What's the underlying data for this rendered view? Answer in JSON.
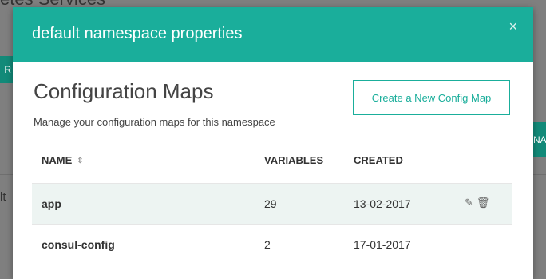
{
  "background": {
    "page_title_fragment": "etes Services",
    "left_tab_fragment": "R",
    "right_tab_fragment": "NA",
    "side_text_fragment": "lt"
  },
  "modal": {
    "title": "default namespace properties",
    "close_icon": "×"
  },
  "section": {
    "title": "Configuration Maps",
    "subtitle": "Manage your configuration maps for this namespace",
    "create_button_label": "Create a New Config Map"
  },
  "table": {
    "headers": {
      "name": "NAME",
      "variables": "VARIABLES",
      "created": "CREATED"
    },
    "sort_icon": "⇕",
    "rows": [
      {
        "name": "app",
        "variables": "29",
        "created": "13-02-2017"
      },
      {
        "name": "consul-config",
        "variables": "2",
        "created": "17-01-2017"
      }
    ],
    "edit_icon": "✎",
    "delete_icon": "🗑"
  },
  "colors": {
    "accent": "#1aae9b",
    "row_highlight": "#edf4f2",
    "overlay": "#7f7f7f"
  }
}
